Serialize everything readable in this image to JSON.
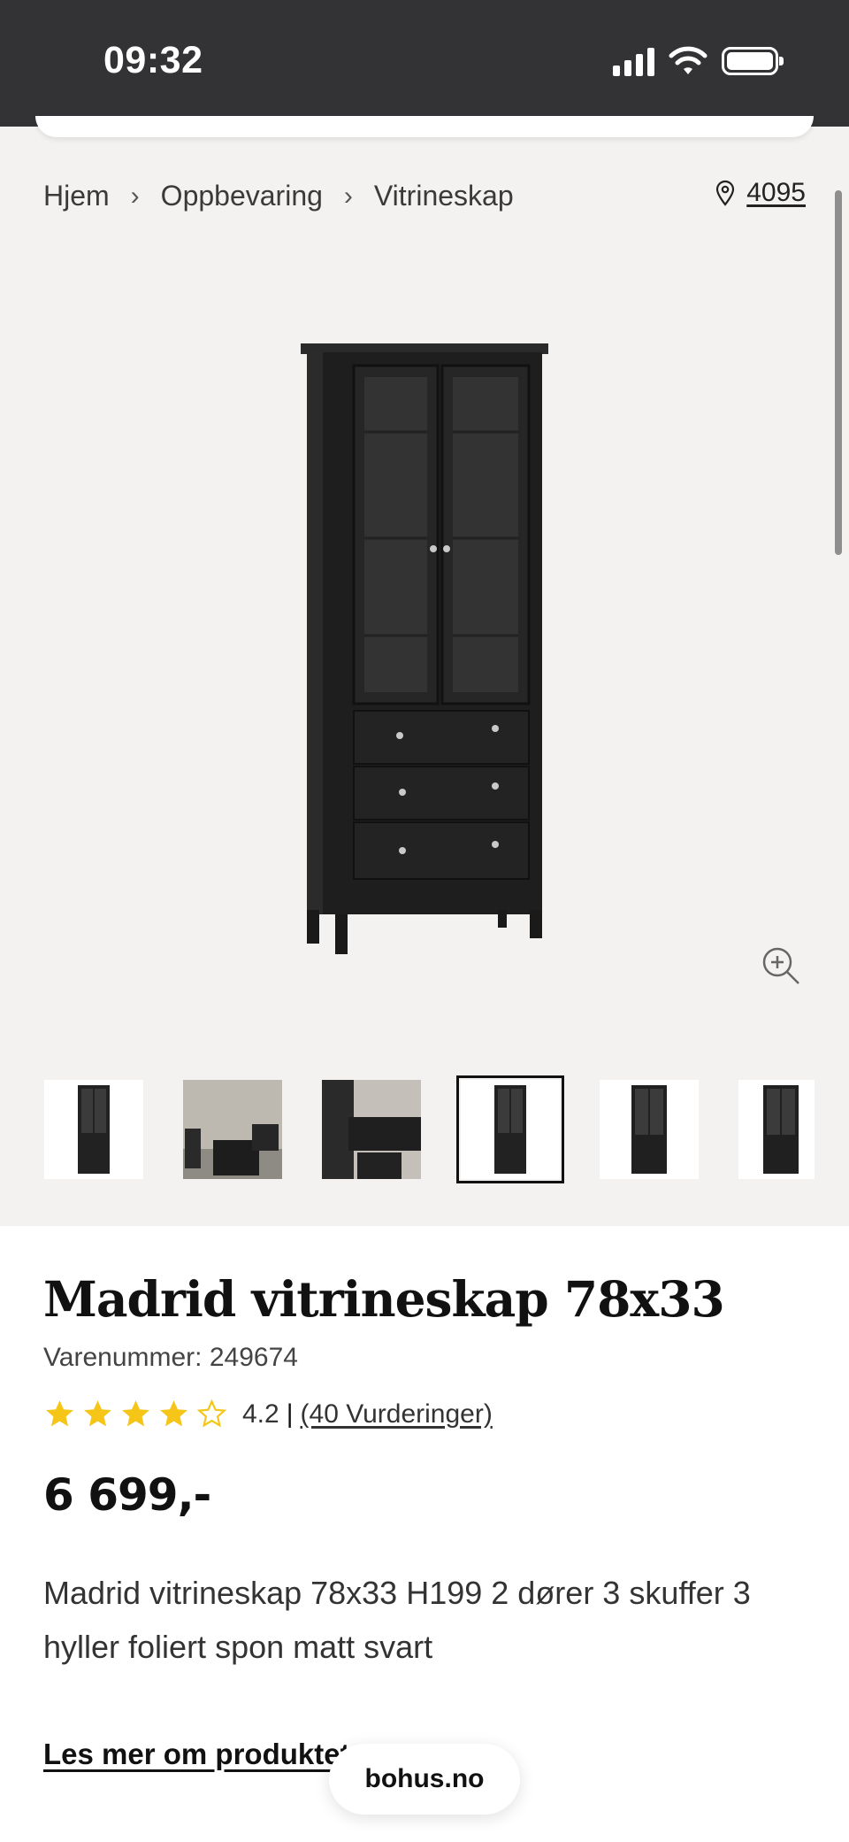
{
  "status_bar": {
    "time": "09:32"
  },
  "breadcrumb": {
    "items": [
      "Hjem",
      "Oppbevaring",
      "Vitrineskap"
    ],
    "separator": ">"
  },
  "store": {
    "icon": "location-pin-icon",
    "number": "4095"
  },
  "gallery": {
    "thumbnail_count": 6,
    "selected_index": 3
  },
  "product": {
    "title": "Madrid vitrineskap 78x33",
    "sku": "Varenummer: 249674",
    "rating": {
      "value": "4.2",
      "separator": "|",
      "count_label": "(40 Vurderinger)",
      "stars_filled": 4,
      "stars_total": 5
    },
    "price": "6 699,-",
    "description": "Madrid vitrineskap 78x33 H199 2 dører 3 skuffer 3 hyller foliert spon matt svart",
    "read_more": "Les mer om produktet"
  },
  "browser": {
    "url": "bohus.no"
  },
  "colors": {
    "status_bar": "#333336",
    "gallery_bg": "#f4f2f0",
    "star": "#f5c518",
    "text": "#111111"
  }
}
